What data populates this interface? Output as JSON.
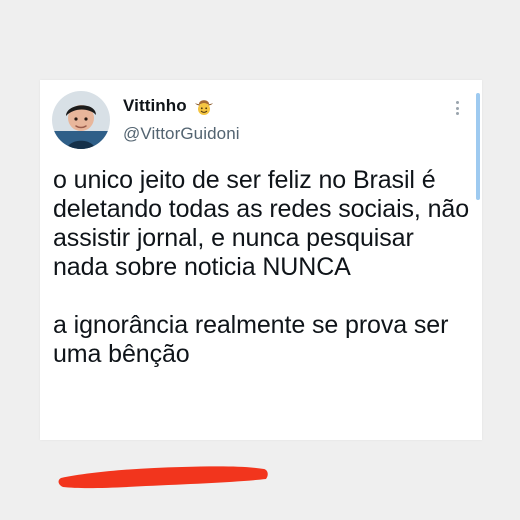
{
  "tweet": {
    "display_name": "Vittinho",
    "handle": "@VittorGuidoni",
    "name_emoji": "cowboy-face-emoji",
    "paragraph_1": "o unico jeito de ser feliz no Brasil é deletando todas as redes sociais, não assistir jornal, e nunca pesquisar nada sobre noticia NUNCA",
    "paragraph_2": "a ignorância realmente se prova ser uma bênção",
    "more_icon": "more-vertical-icon"
  },
  "colors": {
    "background": "#efefef",
    "card": "#ffffff",
    "text": "#0f1419",
    "secondary_text": "#536471",
    "scroll_indicator": "#9ecaf0",
    "redaction_mark": "#f2351d"
  }
}
